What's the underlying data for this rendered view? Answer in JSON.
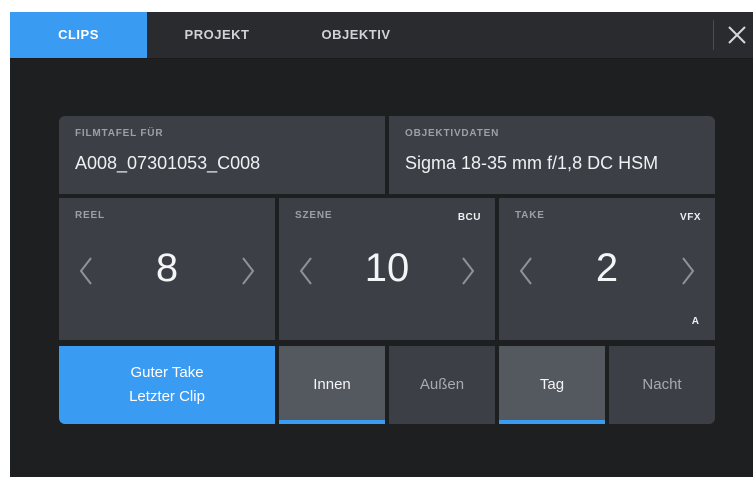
{
  "tabs": [
    {
      "label": "CLIPS",
      "active": true
    },
    {
      "label": "PROJEKT",
      "active": false
    },
    {
      "label": "OBJEKTIV",
      "active": false
    }
  ],
  "filmtafel": {
    "label": "FILMTAFEL FÜR",
    "value": "A008_07301053_C008"
  },
  "objektivdaten": {
    "label": "OBJEKTIVDATEN",
    "value": "Sigma 18-35 mm f/1,8 DC HSM"
  },
  "reel": {
    "label": "REEL",
    "value": "8"
  },
  "szene": {
    "label": "SZENE",
    "value": "10",
    "tag": "BCU"
  },
  "take": {
    "label": "TAKE",
    "value": "2",
    "tag": "VFX",
    "sub_tag": "A"
  },
  "good_take": {
    "line1": "Guter Take",
    "line2": "Letzter Clip"
  },
  "location": {
    "innen": "Innen",
    "aussen": "Außen",
    "selected": "Innen"
  },
  "daytime": {
    "tag": "Tag",
    "nacht": "Nacht",
    "selected": "Tag"
  },
  "colors": {
    "accent": "#3a9bf2",
    "background": "#1e1f21",
    "panel": "#3c3f45",
    "panel_selected": "#54595f"
  },
  "icons": {
    "close": "close-icon",
    "prev": "chevron-left-icon",
    "next": "chevron-right-icon"
  }
}
